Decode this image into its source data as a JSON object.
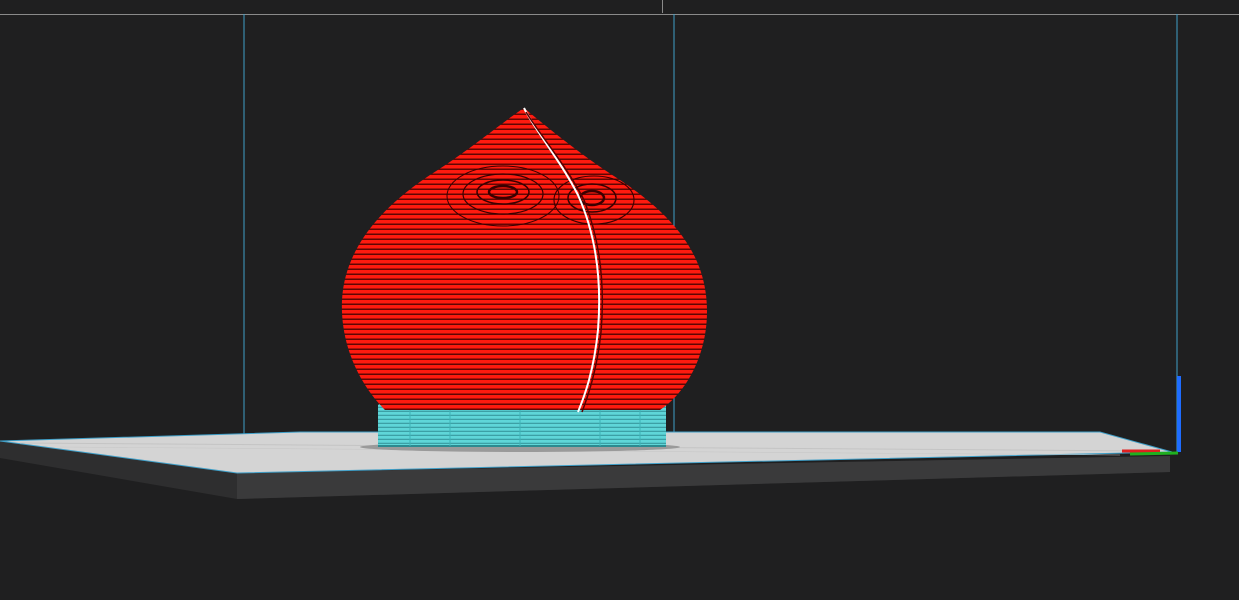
{
  "viewport": {
    "name": "3d-preview-viewport",
    "background_color": "#1f1f20"
  },
  "model": {
    "shape": "peach",
    "body_color": "#ff1a0f",
    "layer_line_color": "#000000",
    "support_color": "#5fd6d8",
    "seam_color": "#ffffff"
  },
  "build_plate": {
    "top_color": "#d6d6d6",
    "edge_color": "#3a3a3a"
  },
  "bounding_box": {
    "line_color": "#3f9fc8"
  },
  "axis_gizmo": {
    "x_axis_color": "#e02020",
    "y_axis_color": "#20b020",
    "z_axis_color": "#1e6cff"
  }
}
